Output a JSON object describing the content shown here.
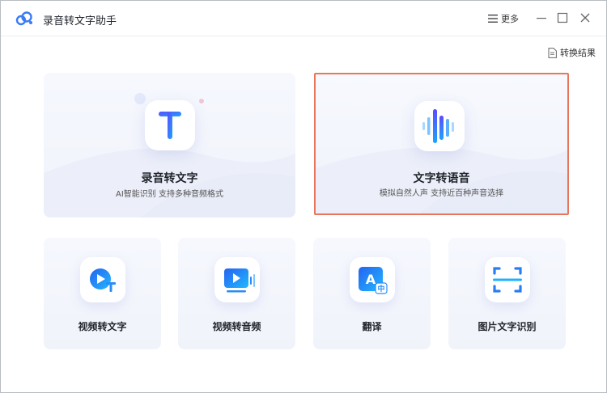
{
  "window": {
    "title": "录音转文字助手",
    "more_label": "更多",
    "results_label": "转换结果"
  },
  "cards": {
    "recording_to_text": {
      "title": "录音转文字",
      "subtitle": "AI智能识别 支持多种音频格式"
    },
    "text_to_speech": {
      "title": "文字转语音",
      "subtitle": "模拟自然人声 支持近百种声音选择"
    },
    "video_to_text": {
      "title": "视频转文字"
    },
    "video_to_audio": {
      "title": "视频转音频"
    },
    "translate": {
      "title": "翻译"
    },
    "image_ocr": {
      "title": "图片文字识别"
    }
  },
  "colors": {
    "accent_blue": "#2f6df6",
    "selected_border": "#e9765a",
    "card_bg": "#f3f5fc"
  },
  "icons": {
    "app_logo": "cloud-chain-icon",
    "more": "menu-icon",
    "results": "document-icon"
  }
}
